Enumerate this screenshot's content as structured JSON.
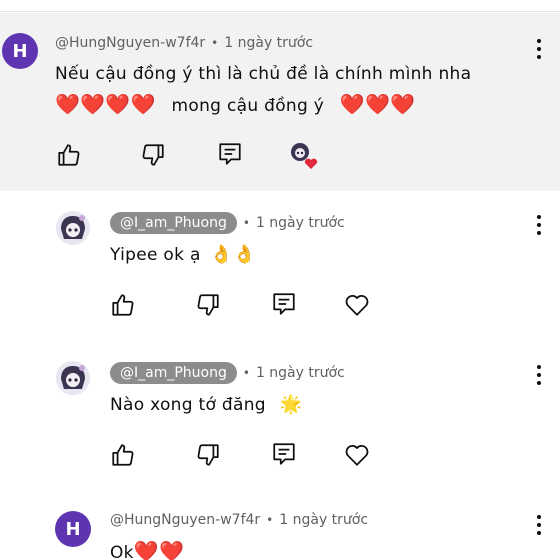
{
  "comments": [
    {
      "avatar_letter": "H",
      "handle": "@HungNguyen-w7f4r",
      "separator": "•",
      "time": "1 ngày trước",
      "text_line1": "Nếu cậu đồng ý thì là chủ đề là chính mình nha",
      "text_line2_hearts_left": "❤️❤️❤️❤️",
      "text_line2_middle": "mong cậu đồng ý",
      "text_line2_hearts_right": "❤️❤️❤️"
    },
    {
      "handle": "@I_am_Phuong",
      "separator": "•",
      "time": "1 ngày trước",
      "text": "Yipee ok ạ",
      "emoji": "👌👌"
    },
    {
      "handle": "@I_am_Phuong",
      "separator": "•",
      "time": "1 ngày trước",
      "text": "Nào xong tớ đăng",
      "emoji": "🌟"
    },
    {
      "avatar_letter": "H",
      "handle": "@HungNguyen-w7f4r",
      "separator": "•",
      "time": "1 ngày trước",
      "text": "Ok",
      "emoji": "❤️❤️"
    }
  ],
  "icons": {
    "like": "thumbs-up-icon",
    "dislike": "thumbs-down-icon",
    "reply": "reply-icon",
    "heart": "heart-icon",
    "more": "more-vertical-icon"
  },
  "colors": {
    "highlight_bg": "#f2f2f2",
    "avatar_bg": "#5e35b1",
    "handle_pill": "#8c8c8c",
    "heart_red": "#e0283a"
  }
}
